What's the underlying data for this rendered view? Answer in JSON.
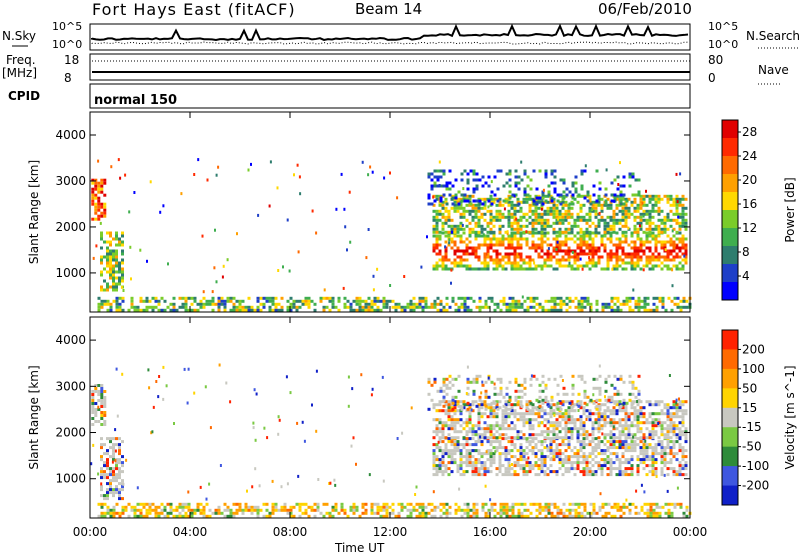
{
  "header": {
    "station": "Fort Hays East (fitACF)",
    "beam": "Beam 14",
    "date": "06/Feb/2010"
  },
  "top_panels": {
    "nsky_label": "N.Sky",
    "nsky_ticks": [
      "10^5",
      "10^0"
    ],
    "nsearch_label": "N.Search",
    "nsearch_ticks": [
      "10^5",
      "10^0"
    ],
    "freq_label": "Freq.",
    "freq_unit": "[MHz]",
    "freq_ticks": [
      "18",
      "8"
    ],
    "nave_label": "Nave",
    "nave_ticks": [
      "80",
      "0"
    ],
    "cpid_label": "CPID",
    "cpid_value": "normal 150"
  },
  "chart_data": [
    {
      "type": "heatmap",
      "panel": "power",
      "xlabel": "",
      "ylabel": "Slant Range [km]",
      "xlim": [
        0,
        24
      ],
      "ylim": [
        150,
        4500
      ],
      "x_ticks": [
        "00:00",
        "04:00",
        "08:00",
        "12:00",
        "16:00",
        "20:00",
        "00:00"
      ],
      "y_ticks": [
        1000,
        2000,
        3000,
        4000
      ],
      "colorbar_label": "Power [dB]",
      "colorbar_ticks": [
        4,
        8,
        12,
        16,
        20,
        24,
        28
      ],
      "colorbar_range": [
        0,
        30
      ],
      "colors": [
        "#0000ff",
        "#1e3fc8",
        "#2e7d6e",
        "#3fae4f",
        "#7acc2a",
        "#ffd800",
        "#ffa000",
        "#ff6a00",
        "#ff2a00",
        "#e00000"
      ],
      "echo_regions": [
        {
          "t": [
            0.05,
            0.55
          ],
          "r": [
            2200,
            3050
          ],
          "level": 0.75
        },
        {
          "t": [
            0.4,
            1.3
          ],
          "r": [
            600,
            1900
          ],
          "level": 0.45
        },
        {
          "t": [
            0.3,
            24.0
          ],
          "r": [
            180,
            480
          ],
          "level": 0.4
        },
        {
          "t": [
            13.7,
            23.9
          ],
          "r": [
            1100,
            1900
          ],
          "level": 0.85
        },
        {
          "t": [
            13.7,
            23.9
          ],
          "r": [
            1900,
            2700
          ],
          "level": 0.45
        },
        {
          "t": [
            13.5,
            22.0
          ],
          "r": [
            2500,
            3250
          ],
          "level": 0.2
        }
      ]
    },
    {
      "type": "heatmap",
      "panel": "velocity",
      "xlabel": "Time UT",
      "ylabel": "Slant Range [km]",
      "xlim": [
        0,
        24
      ],
      "ylim": [
        150,
        4500
      ],
      "x_ticks": [
        "00:00",
        "04:00",
        "08:00",
        "12:00",
        "16:00",
        "20:00",
        "00:00"
      ],
      "y_ticks": [
        1000,
        2000,
        3000,
        4000
      ],
      "colorbar_label": "Velocity [m s^-1]",
      "colorbar_ticks": [
        200,
        100,
        50,
        15,
        -15,
        -50,
        -100,
        -200
      ],
      "colorbar_range": [
        -250,
        250
      ],
      "colors": [
        "#1020c8",
        "#3f57e0",
        "#2e8b3a",
        "#7ac943",
        "#c8c8c0",
        "#ffd400",
        "#ffa000",
        "#ff6a00",
        "#ff2200"
      ],
      "ground_scatter_color": "#c8c8c0",
      "echo_regions": [
        {
          "t": [
            0.05,
            0.55
          ],
          "r": [
            2200,
            3050
          ],
          "level": 0.5
        },
        {
          "t": [
            0.4,
            1.3
          ],
          "r": [
            600,
            1900
          ],
          "level": 0.5
        },
        {
          "t": [
            0.3,
            24.0
          ],
          "r": [
            180,
            480
          ],
          "level": 0.6
        },
        {
          "t": [
            13.7,
            23.9
          ],
          "r": [
            1100,
            1900
          ],
          "level": 0.5
        },
        {
          "t": [
            13.7,
            23.9
          ],
          "r": [
            1900,
            2700
          ],
          "level": 0.5
        },
        {
          "t": [
            13.5,
            22.0
          ],
          "r": [
            2500,
            3250
          ],
          "level": 0.5
        }
      ]
    }
  ]
}
